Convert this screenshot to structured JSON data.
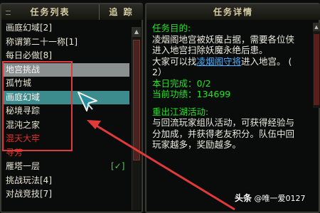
{
  "left_panel": {
    "header_title": "任务列表",
    "header_track": "追 踪",
    "quests": [
      {
        "label": "画庭幻域[2]"
      },
      {
        "label": "称谓第二十一称[1]"
      },
      {
        "label": "每日必做[8]"
      },
      {
        "label": "地宫挑战"
      },
      {
        "label": "孤竹城"
      },
      {
        "label": "画庭幻域"
      },
      {
        "label": "秘境寻踪"
      },
      {
        "label": "混沌之家"
      },
      {
        "label": "混天大牢"
      },
      {
        "label": "寻芳"
      },
      {
        "label": "雁塔一层",
        "check": "[✓]"
      },
      {
        "label": "挑战玩法[4]"
      },
      {
        "label": "对战竞技[7]"
      }
    ]
  },
  "right_panel": {
    "header_title": "任务详情",
    "goal_label": "任务目的:",
    "goal_text_1": "凌烟阁地宫被妖魔占据，需要各位侠",
    "goal_text_2": "进入地宫扫除妖魔永绝后患。",
    "goal_text_3_pre": "大家可以找",
    "goal_link": "凌烟阁守将",
    "goal_text_3_post": "进入地宫。 (",
    "goal_text_4": "2）",
    "done_label": "本日完成：",
    "done_value": "0/2",
    "merit_label": "当前功绩：",
    "merit_value": "134699",
    "reward_title": "重出江湖活动:",
    "reward_text_1": "与回流玩家组队活动，可获得经验与",
    "reward_text_2": "分加成，并获得老友积分。队伍中回",
    "reward_text_3": "玩家越多，奖励越多。"
  },
  "watermark": {
    "prefix": "头条",
    "handle": "@唯一爱0127"
  },
  "colors": {
    "green": "#28e02a",
    "red": "#e0322b",
    "selected_teal": "#3c8b8d",
    "selected_gray": "#8a8f8f",
    "annotation": "#e03a3a",
    "link": "#4fb0ff"
  },
  "icons": {
    "cursor": "pointer-cursor-icon",
    "arrow": "annotation-arrow-icon"
  }
}
